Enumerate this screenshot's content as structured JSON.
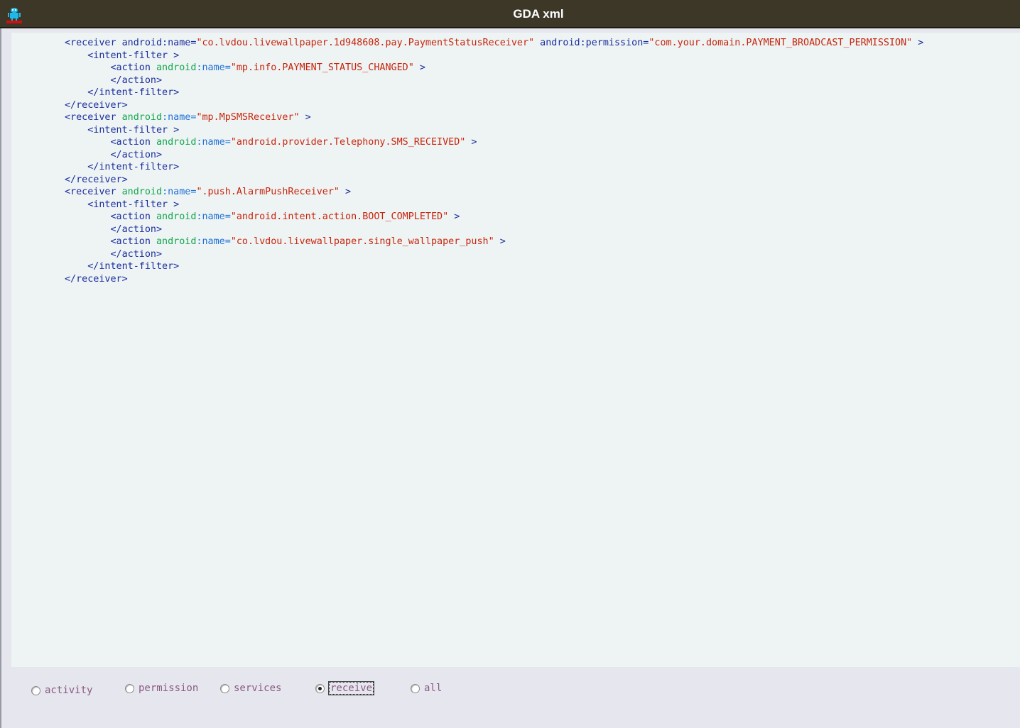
{
  "window": {
    "title": "GDA xml",
    "icon": "android-robot-icon"
  },
  "colors": {
    "titlebar": "#3c3727",
    "tag": "#1a2f9e",
    "attr_green": "#12a84e",
    "attr_name": "#1f72d6",
    "value": "#c8260c",
    "view_bg": "#eef3f4"
  },
  "xml_lines": [
    {
      "indent": 0,
      "parts": [
        {
          "t": "<receiver ",
          "c": "tag"
        },
        {
          "t": "android:name",
          "c": "attr"
        },
        {
          "t": "=",
          "c": "attr"
        },
        {
          "t": "\"co.lvdou.livewallpaper.1d948608.pay.PaymentStatusReceiver\"",
          "c": "val"
        },
        {
          "t": " android:permission",
          "c": "attr"
        },
        {
          "t": "=",
          "c": "attr"
        },
        {
          "t": "\"com.your.domain.PAYMENT_BROADCAST_PERMISSION\"",
          "c": "val"
        },
        {
          "t": " >",
          "c": "tag"
        }
      ]
    },
    {
      "indent": 1,
      "parts": [
        {
          "t": "<intent-filter >",
          "c": "tag"
        }
      ]
    },
    {
      "indent": 2,
      "parts": [
        {
          "t": "<action ",
          "c": "tag"
        },
        {
          "t": "android",
          "c": "attr-green"
        },
        {
          "t": ":name",
          "c": "attr-name"
        },
        {
          "t": "=",
          "c": "attr-name"
        },
        {
          "t": "\"mp.info.PAYMENT_STATUS_CHANGED\"",
          "c": "val"
        },
        {
          "t": " >",
          "c": "tag"
        }
      ]
    },
    {
      "indent": 2,
      "parts": [
        {
          "t": "</action>",
          "c": "tag"
        }
      ]
    },
    {
      "indent": 1,
      "parts": [
        {
          "t": "</intent-filter>",
          "c": "tag"
        }
      ]
    },
    {
      "indent": 0,
      "parts": [
        {
          "t": "</receiver>",
          "c": "tag"
        }
      ]
    },
    {
      "indent": 0,
      "parts": [
        {
          "t": "<receiver ",
          "c": "tag"
        },
        {
          "t": "android",
          "c": "attr-green"
        },
        {
          "t": ":name",
          "c": "attr-name"
        },
        {
          "t": "=",
          "c": "attr-name"
        },
        {
          "t": "\"mp.MpSMSReceiver\"",
          "c": "val"
        },
        {
          "t": " >",
          "c": "tag"
        }
      ]
    },
    {
      "indent": 1,
      "parts": [
        {
          "t": "<intent-filter >",
          "c": "tag"
        }
      ]
    },
    {
      "indent": 2,
      "parts": [
        {
          "t": "<action ",
          "c": "tag"
        },
        {
          "t": "android",
          "c": "attr-green"
        },
        {
          "t": ":name",
          "c": "attr-name"
        },
        {
          "t": "=",
          "c": "attr-name"
        },
        {
          "t": "\"android.provider.Telephony.SMS_RECEIVED\"",
          "c": "val"
        },
        {
          "t": " >",
          "c": "tag"
        }
      ]
    },
    {
      "indent": 2,
      "parts": [
        {
          "t": "</action>",
          "c": "tag"
        }
      ]
    },
    {
      "indent": 1,
      "parts": [
        {
          "t": "</intent-filter>",
          "c": "tag"
        }
      ]
    },
    {
      "indent": 0,
      "parts": [
        {
          "t": "</receiver>",
          "c": "tag"
        }
      ]
    },
    {
      "indent": 0,
      "parts": [
        {
          "t": "<receiver ",
          "c": "tag"
        },
        {
          "t": "android",
          "c": "attr-green"
        },
        {
          "t": ":name",
          "c": "attr-name"
        },
        {
          "t": "=",
          "c": "attr-name"
        },
        {
          "t": "\".push.AlarmPushReceiver\"",
          "c": "val"
        },
        {
          "t": " >",
          "c": "tag"
        }
      ]
    },
    {
      "indent": 1,
      "parts": [
        {
          "t": "<intent-filter >",
          "c": "tag"
        }
      ]
    },
    {
      "indent": 2,
      "parts": [
        {
          "t": "<action ",
          "c": "tag"
        },
        {
          "t": "android",
          "c": "attr-green"
        },
        {
          "t": ":name",
          "c": "attr-name"
        },
        {
          "t": "=",
          "c": "attr-name"
        },
        {
          "t": "\"android.intent.action.BOOT_COMPLETED\"",
          "c": "val"
        },
        {
          "t": " >",
          "c": "tag"
        }
      ]
    },
    {
      "indent": 2,
      "parts": [
        {
          "t": "</action>",
          "c": "tag"
        }
      ]
    },
    {
      "indent": 2,
      "parts": [
        {
          "t": "<action ",
          "c": "tag"
        },
        {
          "t": "android",
          "c": "attr-green"
        },
        {
          "t": ":name",
          "c": "attr-name"
        },
        {
          "t": "=",
          "c": "attr-name"
        },
        {
          "t": "\"co.lvdou.livewallpaper.single_wallpaper_push\"",
          "c": "val"
        },
        {
          "t": " >",
          "c": "tag"
        }
      ]
    },
    {
      "indent": 2,
      "parts": [
        {
          "t": "</action>",
          "c": "tag"
        }
      ]
    },
    {
      "indent": 1,
      "parts": [
        {
          "t": "</intent-filter>",
          "c": "tag"
        }
      ]
    },
    {
      "indent": 0,
      "parts": [
        {
          "t": "</receiver>",
          "c": "tag"
        }
      ]
    }
  ],
  "filters": {
    "options": [
      "activity",
      "permission",
      "services",
      "receive",
      "all"
    ],
    "selected": "receive"
  }
}
